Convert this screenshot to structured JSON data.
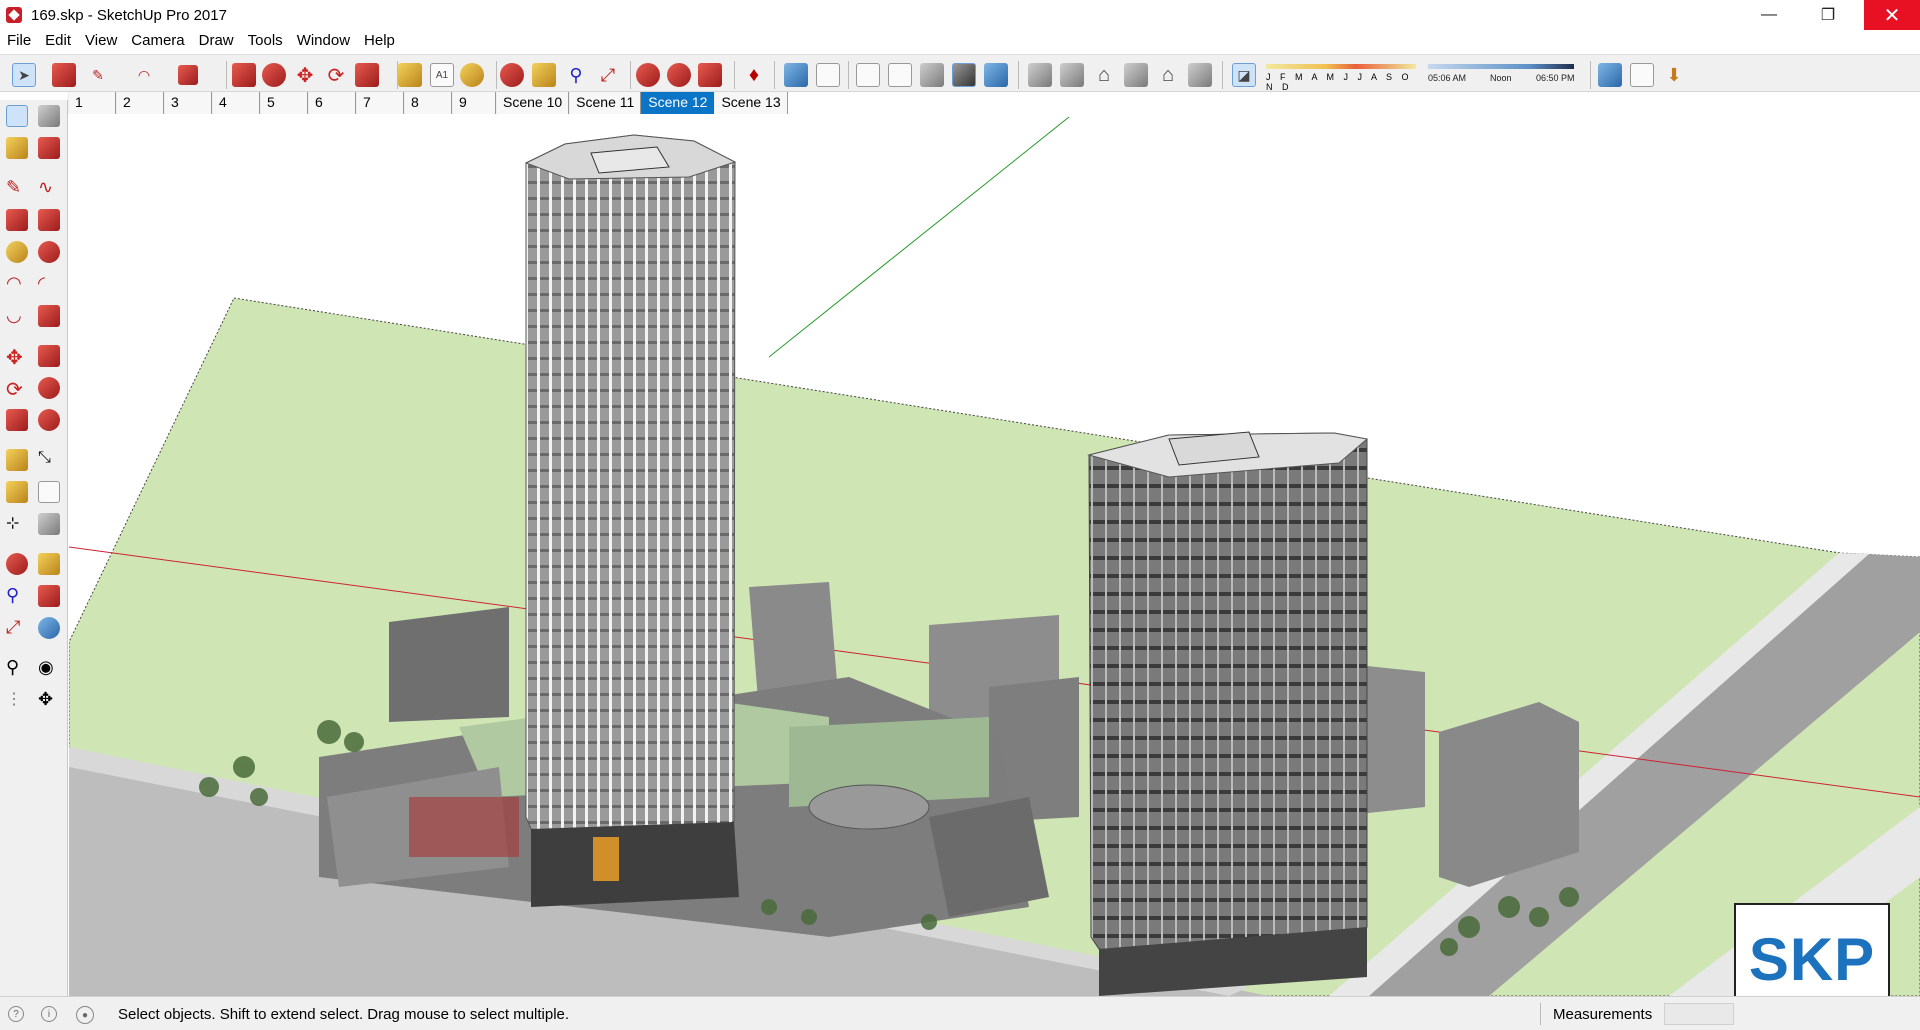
{
  "window": {
    "title": "169.skp - SketchUp Pro 2017",
    "minimize_glyph": "—",
    "restore_glyph": "❐",
    "close_glyph": "✕"
  },
  "menu": [
    "File",
    "Edit",
    "View",
    "Camera",
    "Draw",
    "Tools",
    "Window",
    "Help"
  ],
  "shadow_settings": {
    "months": "J F M A M J J A S O N D",
    "time_start": "05:06 AM",
    "time_mid": "Noon",
    "time_end": "06:50 PM"
  },
  "scenes": {
    "tabs": [
      "1",
      "2",
      "3",
      "4",
      "5",
      "6",
      "7",
      "8",
      "9",
      "Scene 10",
      "Scene 11",
      "Scene 12",
      "Scene 13"
    ],
    "active": "Scene 12"
  },
  "toolbar_icons": [
    "select-icon",
    "eraser-icon",
    "pencil-icon",
    "arc-icon",
    "shape-icon",
    "push-pull-icon",
    "follow-me-icon",
    "move-icon",
    "rotate-icon",
    "scale-icon",
    "tape-measure-icon",
    "text-icon",
    "paint-bucket-icon",
    "orbit-icon",
    "pan-icon",
    "zoom-icon",
    "zoom-extents-icon",
    "warehouse-icon",
    "extension-icon",
    "layout-icon",
    "ruby-icon",
    "xray-icon",
    "back-edges-icon",
    "wireframe-icon",
    "hidden-line-icon",
    "shaded-icon",
    "shaded-textures-icon",
    "monochrome-icon",
    "iso-view-icon",
    "top-view-icon",
    "front-view-icon",
    "right-view-icon",
    "back-view-icon",
    "left-view-icon",
    "shadows-toggle-icon",
    "add-location-icon",
    "terrain-icon",
    "photo-texture-icon"
  ],
  "viewport": {
    "watermark": "SKP"
  },
  "status": {
    "message": "Select objects. Shift to extend select. Drag mouse to select multiple.",
    "measurements_label": "Measurements"
  },
  "colors": {
    "accent": "#0a74c6",
    "close_button": "#e81123",
    "ground": "#cfe6b4",
    "tower": "#8a8a8a"
  }
}
